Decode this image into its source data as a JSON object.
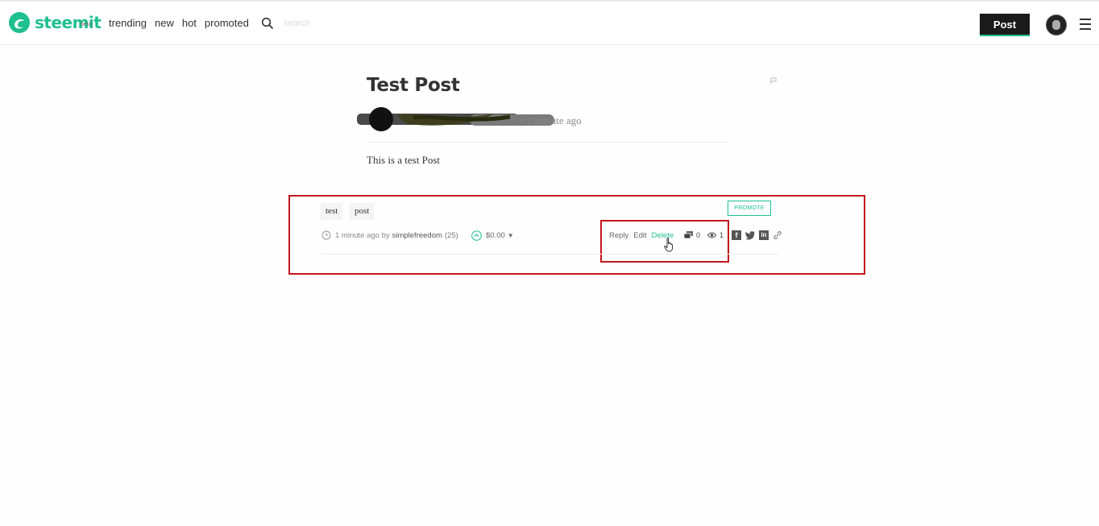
{
  "header": {
    "logo_text": "steemit",
    "logo_badge": "beta",
    "nav": [
      "trending",
      "new",
      "hot",
      "promoted"
    ],
    "search_placeholder": "search",
    "post_button": "Post",
    "brand_color": "#1fbf8f"
  },
  "post": {
    "title": "Test Post",
    "time": "• 1 minute ago",
    "body": "This is a test Post"
  },
  "footer": {
    "tags": [
      "test",
      "post"
    ],
    "promote_label": "PROMOTE",
    "meta_time": "1 minute ago by",
    "meta_author": "simplefreedom",
    "meta_rep": "(25)",
    "payout": "$0.00",
    "actions": {
      "reply": "Reply",
      "edit": "Edit",
      "delete": "Delete"
    },
    "comment_count": "0",
    "view_count": "1",
    "share_icons": [
      "facebook-icon",
      "twitter-icon",
      "linkedin-icon",
      "link-icon"
    ],
    "highlight_color": "#c4161c"
  }
}
